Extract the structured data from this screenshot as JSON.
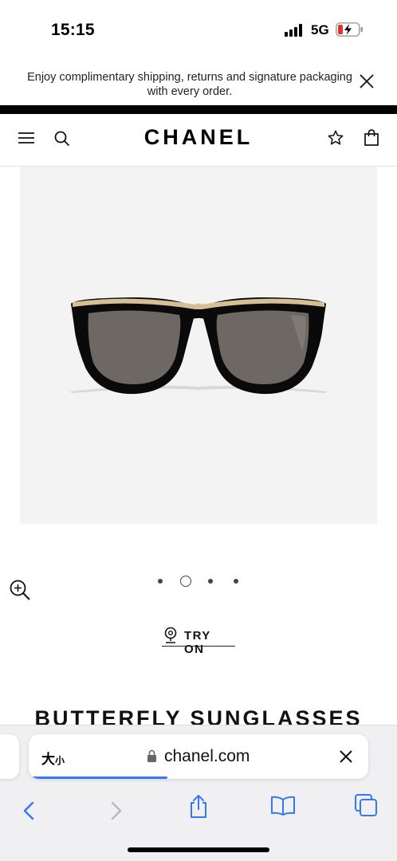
{
  "status_bar": {
    "time": "15:15",
    "network": "5G",
    "signal_bars": 4,
    "battery_icon": "battery-charging-icon",
    "battery_color": "#e5322d"
  },
  "promo": {
    "message": "Enjoy complimentary shipping, returns and signature packaging with every order.",
    "close_icon": "close-icon"
  },
  "header": {
    "logo": "CHANEL",
    "menu_icon": "menu-icon",
    "search_icon": "search-icon",
    "wishlist_icon": "star-icon",
    "bag_icon": "shopping-bag-icon"
  },
  "product": {
    "image_icon": "sunglasses-image",
    "zoom_icon": "zoom-in-icon",
    "carousel": {
      "count": 4,
      "active_index": 1
    },
    "try_on_label": "TRY ON",
    "try_on_icon": "location-pin-icon",
    "title": "BUTTERFLY SUNGLASSES"
  },
  "browser": {
    "text_size_label_large": "大",
    "text_size_label_small": "小",
    "url": "chanel.com",
    "lock_icon": "lock-icon",
    "clear_icon": "clear-icon",
    "load_progress": 0.4,
    "accent_color": "#3478f6",
    "toolbar": [
      "back-icon",
      "forward-icon",
      "share-icon",
      "bookmarks-icon",
      "tabs-icon"
    ]
  }
}
